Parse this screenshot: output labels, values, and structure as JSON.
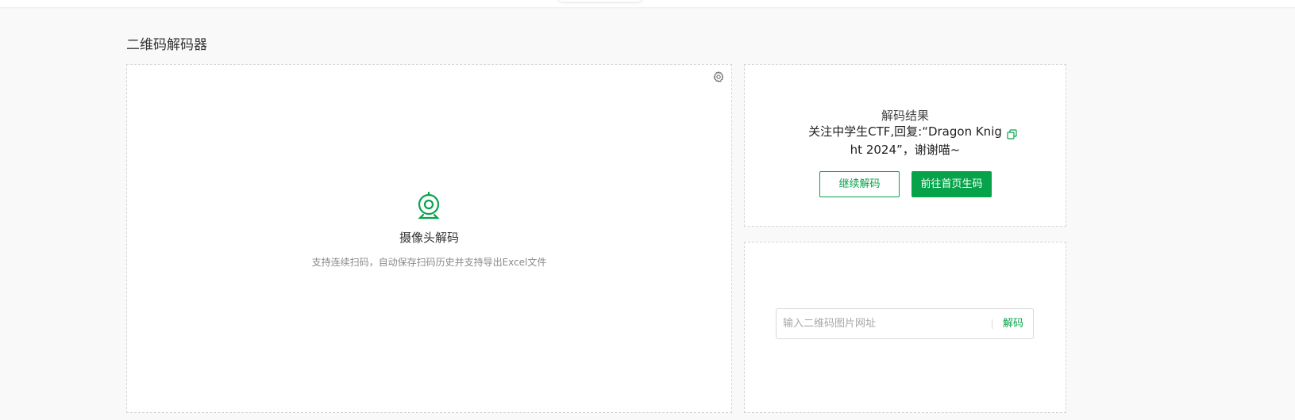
{
  "page": {
    "title": "二维码解码器"
  },
  "camera": {
    "title": "摄像头解码",
    "description": "支持连续扫码，自动保存扫码历史并支持导出Excel文件",
    "settings_icon": "gear-icon",
    "camera_icon": "webcam-icon"
  },
  "result": {
    "label": "解码结果",
    "text": "关注中学生CTF,回复:“Dragon Knight 2024”，谢谢喵~",
    "copy_icon": "copy-icon",
    "continue_button": "继续解码",
    "home_button": "前往首页生码"
  },
  "url_decode": {
    "placeholder": "输入二维码图片网址",
    "value": "",
    "button": "解码"
  },
  "colors": {
    "accent": "#07a34a",
    "background": "#f9f9f9",
    "panel_border": "#d5d5d5"
  }
}
